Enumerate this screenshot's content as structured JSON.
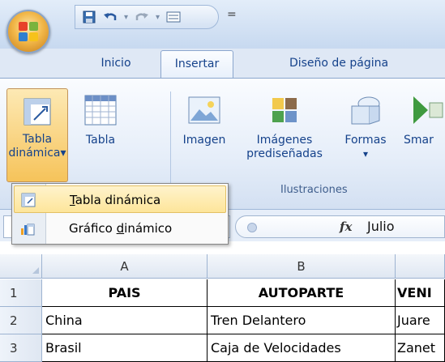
{
  "quick_access": {
    "icons": [
      "save-icon",
      "undo-icon",
      "redo-icon",
      "form-icon"
    ],
    "customize_label": "="
  },
  "tabs": [
    {
      "label": "Inicio",
      "active": false
    },
    {
      "label": "Insertar",
      "active": true
    },
    {
      "label": "Diseño de página",
      "active": false
    }
  ],
  "ribbon": {
    "tabla_dinamica": {
      "line1": "Tabla",
      "line2": "dinámica",
      "arrow": "▾"
    },
    "tabla": {
      "label": "Tabla"
    },
    "imagen": {
      "label": "Imagen"
    },
    "imagenes_prediseñadas": {
      "line1": "Imágenes",
      "line2": "prediseñadas"
    },
    "formas": {
      "label": "Formas",
      "arrow": "▾"
    },
    "smartart": {
      "label": "Smar"
    },
    "group_ilustraciones": "Ilustraciones"
  },
  "dropdown": {
    "items": [
      {
        "label_prefix": "",
        "label_underline": "T",
        "label_rest": "abla dinámica",
        "highlighted": true,
        "icon": "pivot-table-icon"
      },
      {
        "label_prefix": "Gráfico ",
        "label_underline": "d",
        "label_rest": "inámico",
        "highlighted": false,
        "icon": "pivot-chart-icon"
      }
    ]
  },
  "formula_bar": {
    "fx": "fx",
    "value": "Julio"
  },
  "sheet": {
    "columns": [
      "A",
      "B",
      ""
    ],
    "rows": [
      {
        "num": "1",
        "cells": [
          "PAIS",
          "AUTOPARTE",
          "VENI"
        ],
        "header": true
      },
      {
        "num": "2",
        "cells": [
          "China",
          "Tren Delantero",
          "Juare"
        ],
        "header": false
      },
      {
        "num": "3",
        "cells": [
          "Brasil",
          "Caja de Velocidades",
          "Zanet"
        ],
        "header": false
      }
    ]
  },
  "colors": {
    "ribbon_text": "#15428b",
    "pressed_bg": "#f6c35a",
    "highlight_bg": "#fde59a"
  }
}
